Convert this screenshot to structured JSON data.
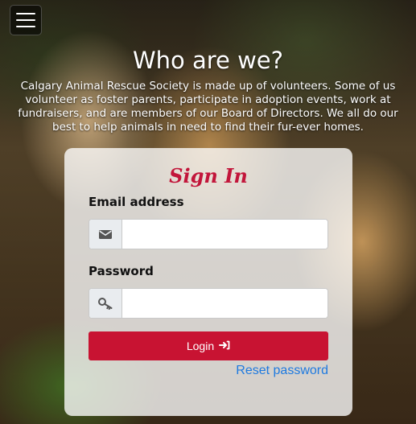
{
  "nav": {
    "menu_icon": "hamburger-menu-icon"
  },
  "hero": {
    "title": "Who are we?",
    "text": "Calgary Animal Rescue Society is made up of volunteers. Some of us volunteer as foster parents, participate in adoption events, work at fundraisers, and are members of our Board of Directors. We all do our best to help animals in need to find their fur-ever homes."
  },
  "signin": {
    "title": "Sign In",
    "email_label": "Email address",
    "email_value": "",
    "email_placeholder": "",
    "email_icon": "envelope-icon",
    "password_label": "Password",
    "password_value": "",
    "password_placeholder": "",
    "password_icon": "key-icon",
    "login_label": "Login",
    "login_icon": "sign-in-icon",
    "reset_label": "Reset password"
  },
  "colors": {
    "accent": "#c81332",
    "title": "#c2153a",
    "link": "#1f7ae0"
  }
}
